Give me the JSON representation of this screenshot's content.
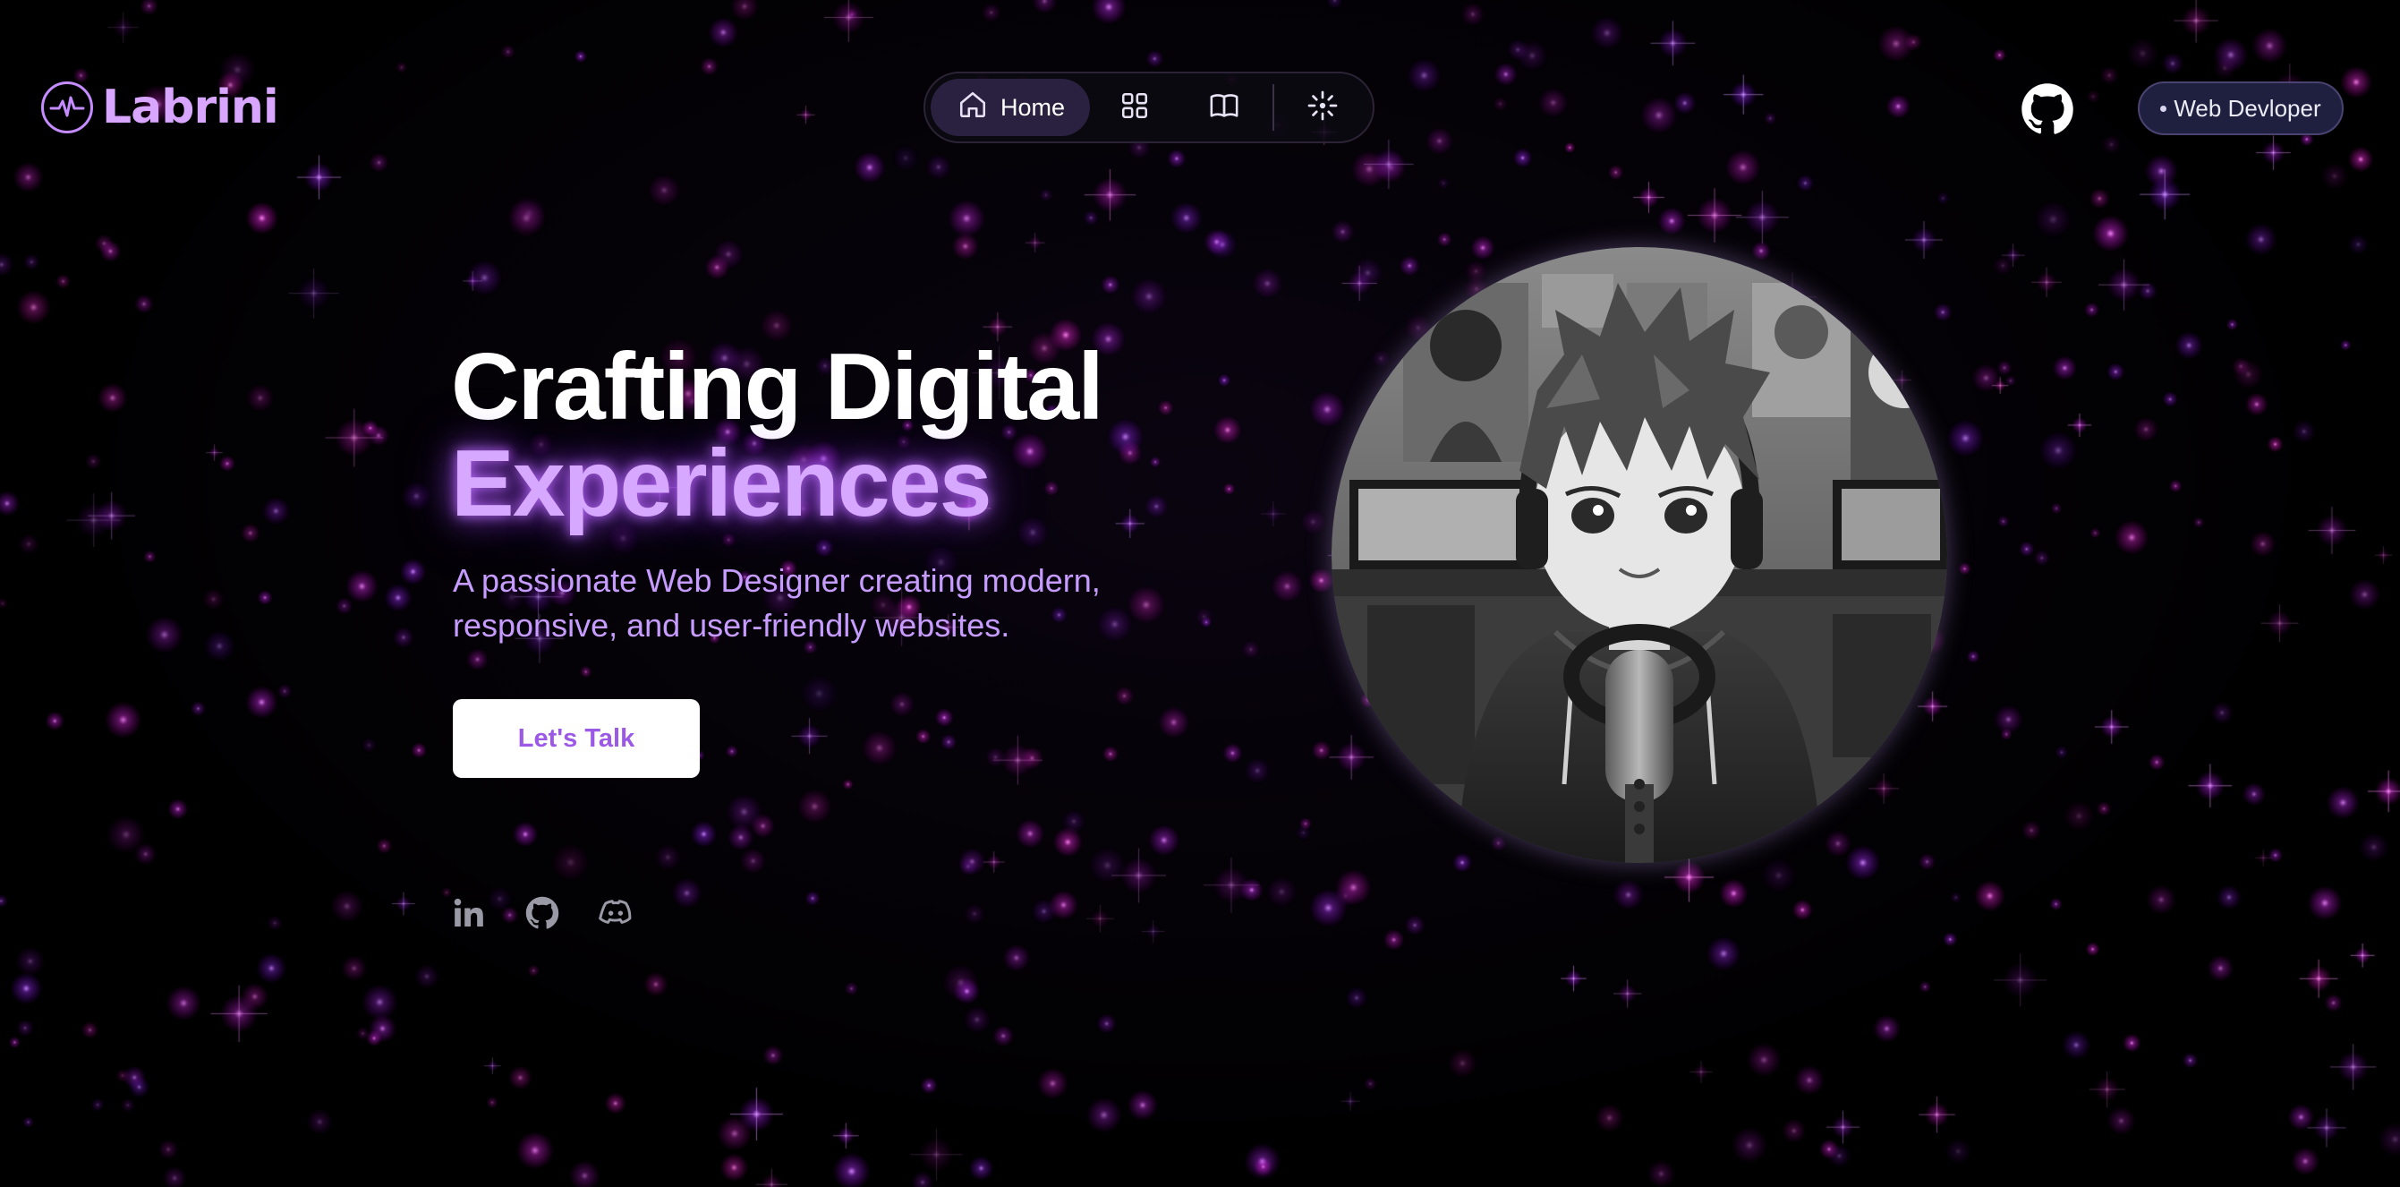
{
  "header": {
    "logo_text": "Labrini",
    "logo_icon": "pulse-icon",
    "nav": {
      "home_label": "Home",
      "items": [
        {
          "icon": "home-icon",
          "label": "Home",
          "active": true
        },
        {
          "icon": "grid-icon"
        },
        {
          "icon": "book-icon"
        },
        {
          "icon": "sparkle-icon"
        }
      ]
    },
    "github_icon": "github-icon",
    "role_badge": "Web Devloper"
  },
  "hero": {
    "title_line1": "Crafting Digital",
    "title_line2": "Experiences",
    "subtitle": "A passionate Web Designer creating modern, responsive, and user-friendly websites.",
    "cta_label": "Let's Talk"
  },
  "socials": [
    {
      "icon": "linkedin-icon"
    },
    {
      "icon": "github-icon"
    },
    {
      "icon": "discord-icon"
    }
  ],
  "avatar": {
    "description_icon": "anime-streamer-avatar"
  },
  "colors": {
    "background": "#000000",
    "accent": "#d7a8ff",
    "accent_text": "#c79cff",
    "button_text": "#9b59e6",
    "badge_bg": "#1f2040",
    "nav_active_bg": "#2a2040"
  }
}
